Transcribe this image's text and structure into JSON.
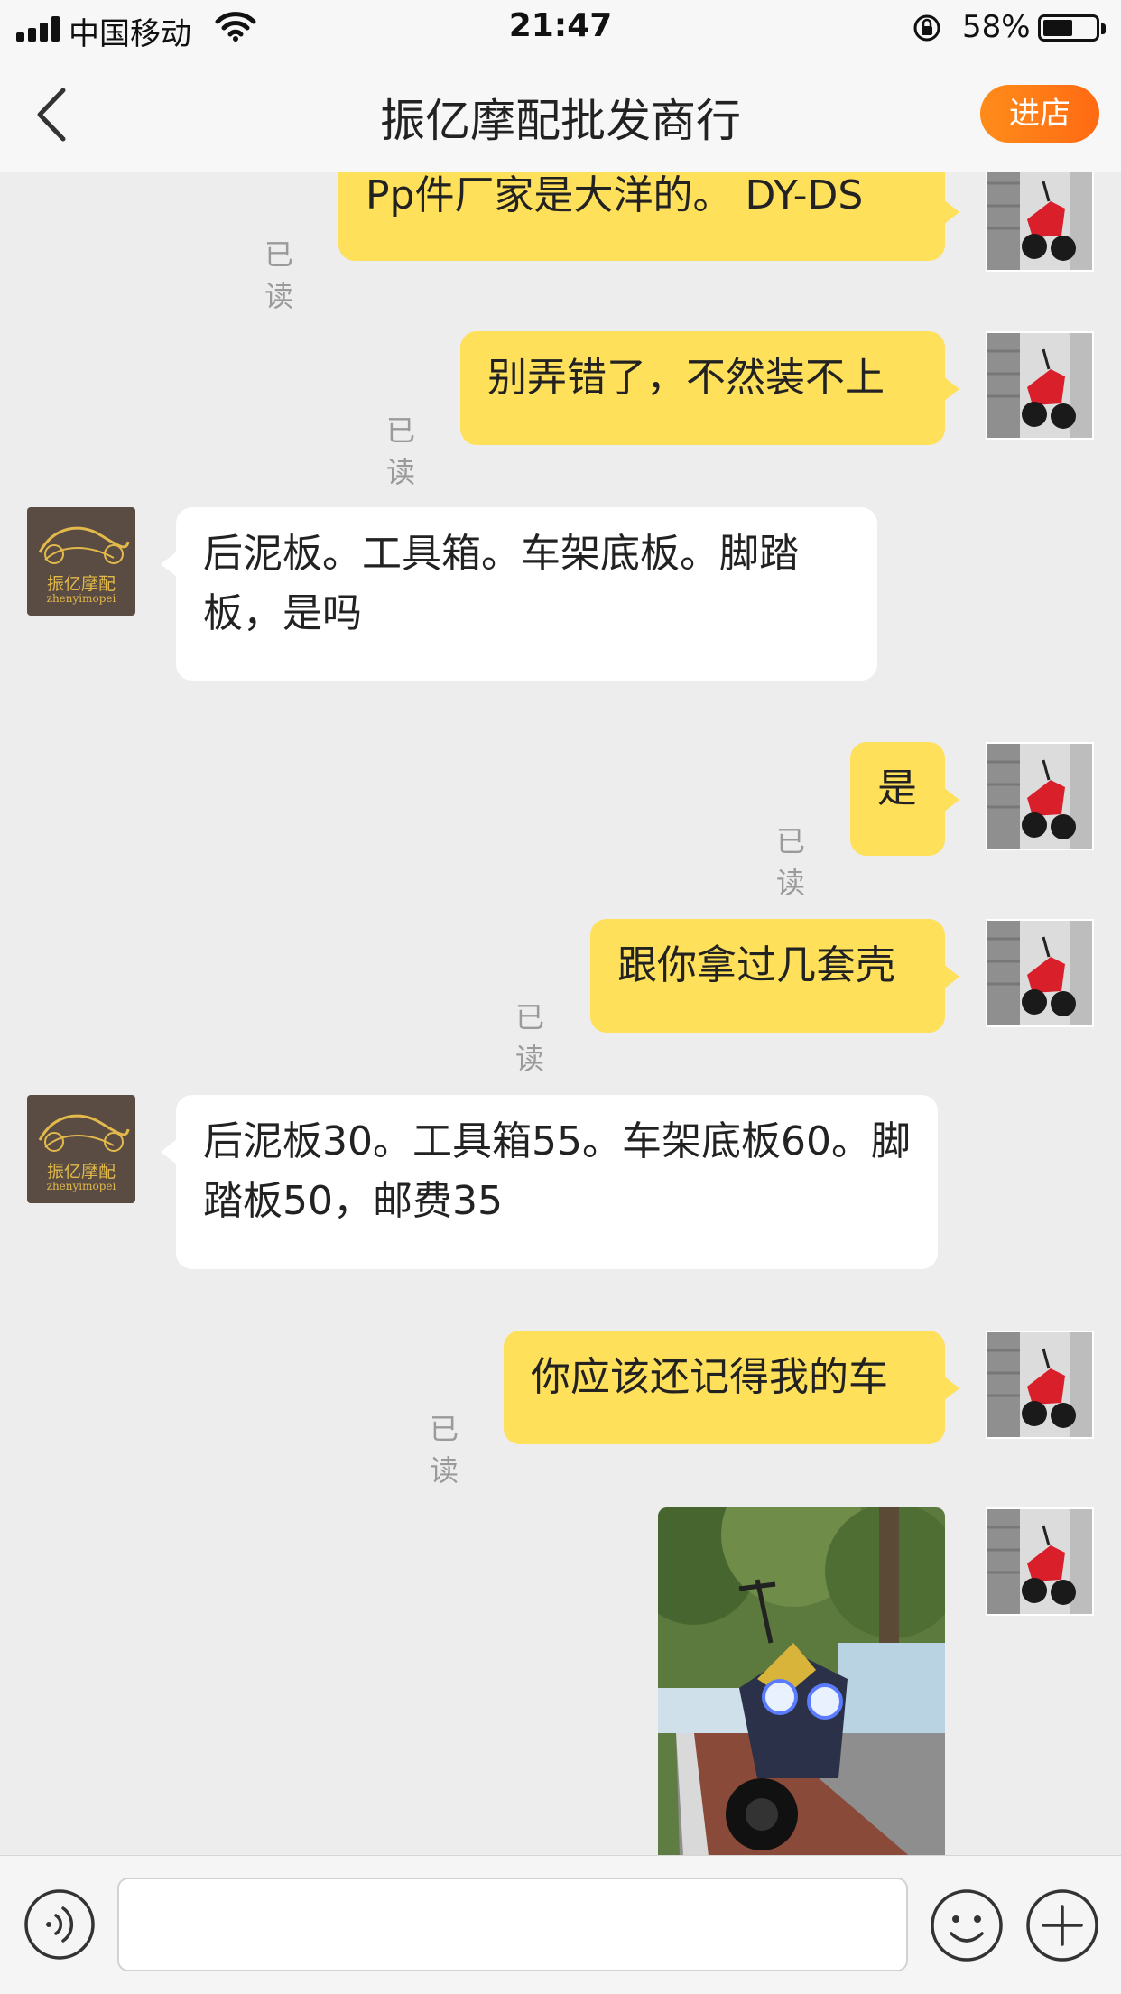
{
  "status_bar": {
    "carrier": "中国移动",
    "time": "21:47",
    "battery_percent": "58%",
    "battery_level": 0.58
  },
  "nav": {
    "title": "振亿摩配批发商行",
    "shop_button": "进店"
  },
  "shop_avatar": {
    "name_cn": "振亿摩配",
    "name_en": "zhenyimopei"
  },
  "messages": [
    {
      "from": "me",
      "text": "Pp件厂家是大洋的。 DY-DS",
      "status": "已读"
    },
    {
      "from": "me",
      "text": "别弄错了，不然装不上",
      "status": "已读"
    },
    {
      "from": "shop",
      "text": "后泥板。工具箱。车架底板。脚踏板，是吗"
    },
    {
      "from": "me",
      "text": "是",
      "status": "已读"
    },
    {
      "from": "me",
      "text": "跟你拿过几套壳",
      "status": "已读"
    },
    {
      "from": "shop",
      "text": "后泥板30。工具箱55。车架底板60。脚踏板50，邮费35"
    },
    {
      "from": "me",
      "text": "你应该还记得我的车",
      "status": "已读"
    },
    {
      "from": "me",
      "type": "image",
      "subject": "motorcycle-photo"
    }
  ],
  "input": {
    "placeholder": ""
  },
  "colors": {
    "outgoing_bubble": "#ffe05a",
    "incoming_bubble": "#ffffff",
    "accent": "#ff7a18",
    "background": "#ededed"
  },
  "icons": [
    "signal-icon",
    "wifi-icon",
    "rotation-lock-icon",
    "battery-icon",
    "back-icon",
    "voice-icon",
    "emoji-icon",
    "plus-icon"
  ]
}
